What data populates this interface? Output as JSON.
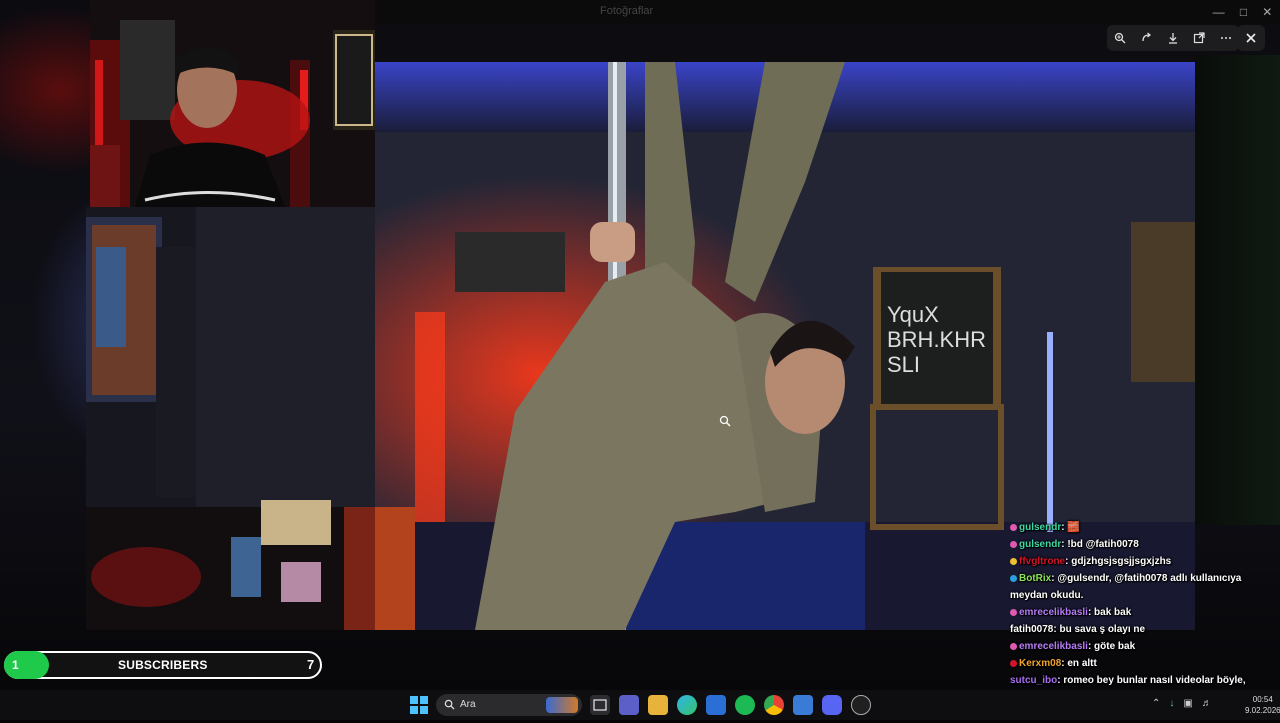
{
  "viewer": {
    "title": "Fotoğraflar",
    "toolbar": [
      "zoom-icon",
      "rotate-icon",
      "download-icon",
      "open-external-icon",
      "more-icon"
    ],
    "close": "close-icon"
  },
  "overlay": {
    "subscribers": {
      "label": "SUBSCRIBERS",
      "current": "1",
      "goal": "7",
      "progress": 0.14,
      "fill_color": "#1fc94a"
    }
  },
  "chat": [
    {
      "user": "gulsendr",
      "color": "#3dd9a5",
      "text": ": 🧱"
    },
    {
      "user": "gulsendr",
      "color": "#3dd9a5",
      "text": ": !bd @fatih0078"
    },
    {
      "user": "ffvgltrone",
      "color": "#d4142a",
      "text": ": gdjzhgsjsgsjjsgxjzhs"
    },
    {
      "user": "BotRix",
      "color": "#8be45a",
      "text": ": @gulsendr, @fatih0078 adlı kullanıcıya meydan okudu."
    },
    {
      "user": "emrecelikbasli",
      "color": "#b57cf5",
      "text": ": bak bak"
    },
    {
      "user": "fatih0078",
      "color": "#ffffff",
      "text": ": bu sava ş olayı ne"
    },
    {
      "user": "emrecelikbasli",
      "color": "#b57cf5",
      "text": ": göte bak"
    },
    {
      "user": "Kerxm08",
      "color": "#f0a52a",
      "text": ": en altt"
    },
    {
      "user": "sutcu_ibo",
      "color": "#a66cf0",
      "text": ": romeo bey bunlar nasıl videolar böyle, bunları gördükten sonra kumar hafif kalır, sizin adınıza ben utandım"
    }
  ],
  "taskbar": {
    "search_placeholder": "Ara",
    "apps": [
      "task-view-icon",
      "teams-icon",
      "file-explorer-icon",
      "edge-icon",
      "store-icon",
      "spotify-icon",
      "chrome-icon",
      "app-icon",
      "discord-icon",
      "app-badge-icon"
    ],
    "time": "00:54",
    "date": "9.02.2026"
  }
}
